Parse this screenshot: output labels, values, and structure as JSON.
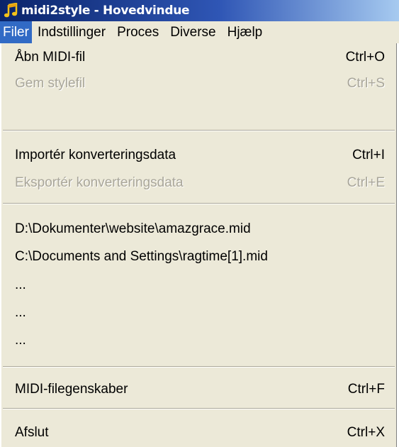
{
  "window": {
    "title": "midi2style - Hovedvindue"
  },
  "menubar": {
    "items": [
      {
        "label": "Filer",
        "active": true
      },
      {
        "label": "Indstillinger",
        "active": false
      },
      {
        "label": "Proces",
        "active": false
      },
      {
        "label": "Diverse",
        "active": false
      },
      {
        "label": "Hjælp",
        "active": false
      }
    ]
  },
  "file_menu": {
    "items": [
      {
        "label": "Åbn MIDI-fil",
        "shortcut": "Ctrl+O",
        "enabled": true
      },
      {
        "label": "Gem stylefil",
        "shortcut": "Ctrl+S",
        "enabled": false
      },
      {
        "label": "Importér konverteringsdata",
        "shortcut": "Ctrl+I",
        "enabled": true
      },
      {
        "label": "Eksportér konverteringsdata",
        "shortcut": "Ctrl+E",
        "enabled": false
      },
      {
        "label": "D:\\Dokumenter\\website\\amazgrace.mid",
        "shortcut": "",
        "enabled": true
      },
      {
        "label": "C:\\Documents and Settings\\ragtime[1].mid",
        "shortcut": "",
        "enabled": true
      },
      {
        "label": "...",
        "shortcut": "",
        "enabled": true
      },
      {
        "label": "...",
        "shortcut": "",
        "enabled": true
      },
      {
        "label": "...",
        "shortcut": "",
        "enabled": true
      },
      {
        "label": "MIDI-filegenskaber",
        "shortcut": "Ctrl+F",
        "enabled": true
      },
      {
        "label": "Afslut",
        "shortcut": "Ctrl+X",
        "enabled": true
      }
    ]
  },
  "colors": {
    "menu_background": "#ece9d8",
    "highlight": "#316ac5",
    "disabled_text": "#a9a69a",
    "title_gradient_start": "#0a246a"
  },
  "icons": {
    "app": "music-note-icon"
  }
}
